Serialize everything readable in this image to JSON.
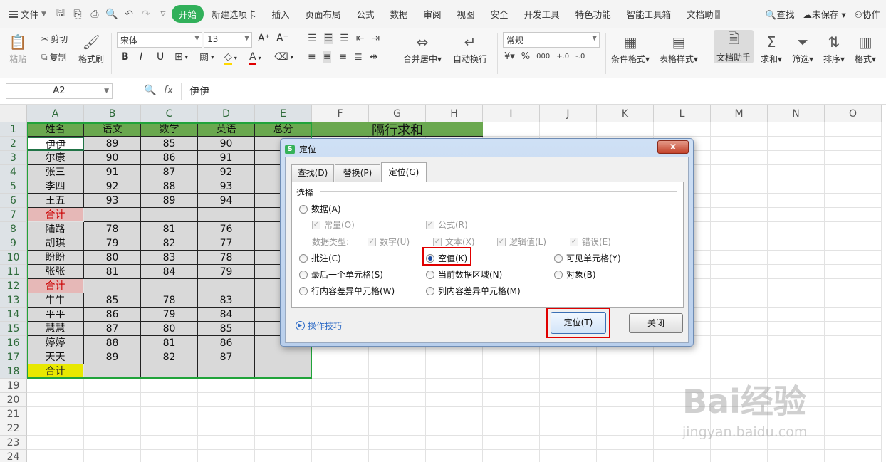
{
  "menubar": {
    "file": "文件",
    "tabs": [
      "开始",
      "新建选项卡",
      "插入",
      "页面布局",
      "公式",
      "数据",
      "审阅",
      "视图",
      "安全",
      "开发工具",
      "特色功能",
      "智能工具箱",
      "文档助"
    ],
    "search": "查找",
    "unsaved": "未保存",
    "collab": "协作"
  },
  "ribbon": {
    "paste": "粘贴",
    "cut": "剪切",
    "copy": "复制",
    "format_painter": "格式刷",
    "font_name": "宋体",
    "font_size": "13",
    "merge_center": "合并居中",
    "wrap": "自动换行",
    "number_format": "常规",
    "cond_format": "条件格式",
    "table_style": "表格样式",
    "doc_assistant": "文档助手",
    "sum": "求和",
    "filter": "筛选",
    "sort": "排序",
    "format": "格式",
    "grow_font": "A⁺",
    "shrink_font": "A⁻",
    "bold": "B",
    "italic": "I",
    "underline": "U",
    "percent": "%",
    "thousands": "000"
  },
  "formula_bar": {
    "name_box": "A2",
    "fx": "fx",
    "value": "伊伊"
  },
  "sheet": {
    "columns": [
      "A",
      "B",
      "C",
      "D",
      "E",
      "F",
      "G",
      "H",
      "I",
      "J",
      "K",
      "L",
      "M",
      "N",
      "O"
    ],
    "rows": [
      "1",
      "2",
      "3",
      "4",
      "5",
      "6",
      "7",
      "8",
      "9",
      "10",
      "11",
      "12",
      "13",
      "14",
      "15",
      "16",
      "17",
      "18",
      "19",
      "20",
      "21",
      "22",
      "23",
      "24"
    ],
    "header": [
      "姓名",
      "语文",
      "数学",
      "英语",
      "总分"
    ],
    "data": [
      [
        "伊伊",
        "89",
        "85",
        "90",
        ""
      ],
      [
        "尔康",
        "90",
        "86",
        "91",
        ""
      ],
      [
        "张三",
        "91",
        "87",
        "92",
        ""
      ],
      [
        "李四",
        "92",
        "88",
        "93",
        ""
      ],
      [
        "王五",
        "93",
        "89",
        "94",
        ""
      ],
      [
        "合计",
        "",
        "",
        "",
        ""
      ],
      [
        "陆路",
        "78",
        "81",
        "76",
        ""
      ],
      [
        "胡琪",
        "79",
        "82",
        "77",
        ""
      ],
      [
        "盼盼",
        "80",
        "83",
        "78",
        ""
      ],
      [
        "张张",
        "81",
        "84",
        "79",
        ""
      ],
      [
        "合计",
        "",
        "",
        "",
        ""
      ],
      [
        "牛牛",
        "85",
        "78",
        "83",
        ""
      ],
      [
        "平平",
        "86",
        "79",
        "84",
        ""
      ],
      [
        "慧慧",
        "87",
        "80",
        "85",
        ""
      ],
      [
        "婷婷",
        "88",
        "81",
        "86",
        ""
      ],
      [
        "天天",
        "89",
        "82",
        "87",
        ""
      ],
      [
        "合计",
        "",
        "",
        "",
        ""
      ]
    ],
    "merged_title": "隔行求和"
  },
  "dialog": {
    "title": "定位",
    "close_x": "x",
    "tabs": [
      "查找(D)",
      "替换(P)",
      "定位(G)"
    ],
    "section": "选择",
    "data_radio": "数据(A)",
    "constants": "常量(O)",
    "formulas": "公式(R)",
    "data_type_label": "数据类型:",
    "number": "数字(U)",
    "text": "文本(X)",
    "logical": "逻辑值(L)",
    "error": "错误(E)",
    "comments": "批注(C)",
    "blanks": "空值(K)",
    "visible_cells": "可见单元格(Y)",
    "last_cell": "最后一个单元格(S)",
    "current_region": "当前数据区域(N)",
    "objects": "对象(B)",
    "row_diff": "行内容差异单元格(W)",
    "col_diff": "列内容差异单元格(M)",
    "tips": "操作技巧",
    "goto_btn": "定位(T)",
    "close_btn": "关闭"
  },
  "watermark": {
    "line1": "Bai经验",
    "line2": "jingyan.baidu.com"
  }
}
